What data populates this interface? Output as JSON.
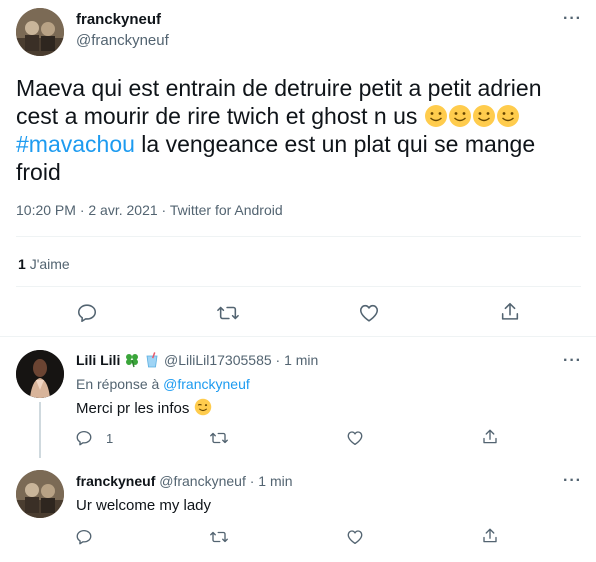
{
  "main_tweet": {
    "display_name": "franckyneuf",
    "handle": "@franckyneuf",
    "text_line1": "Maeva qui est entrain de detruire petit a petit adrien",
    "text_line2": "cest a mourir de rire twich et ghost n us",
    "hashtag": "#mavachou",
    "text_line3": " la vengeance est un plat qui se mange",
    "text_line4": "froid",
    "meta": "10:20 PM · 2 avr. 2021 · Twitter for Android",
    "likes_count": "1",
    "likes_label": "J'aime"
  },
  "reply1": {
    "display_name": "Lili Lili",
    "handle_time": "@LiliLil17305585 · 1 min",
    "reply_prefix": "En réponse à ",
    "reply_to": "@franckyneuf",
    "text": "Merci pr les infos",
    "reply_count": "1"
  },
  "reply2": {
    "display_name": "franckyneuf",
    "handle_time": "@franckyneuf · 1 min",
    "text": "Ur welcome my lady"
  },
  "colors": {
    "accent": "#1d9bf0",
    "secondary_text": "#536471",
    "separator": "#eff3f4"
  },
  "icons": [
    "more-icon",
    "reply-icon",
    "retweet-icon",
    "like-icon",
    "share-icon",
    "smiley-emoji",
    "clover-emoji",
    "cup-emoji",
    "wink-emoji"
  ]
}
